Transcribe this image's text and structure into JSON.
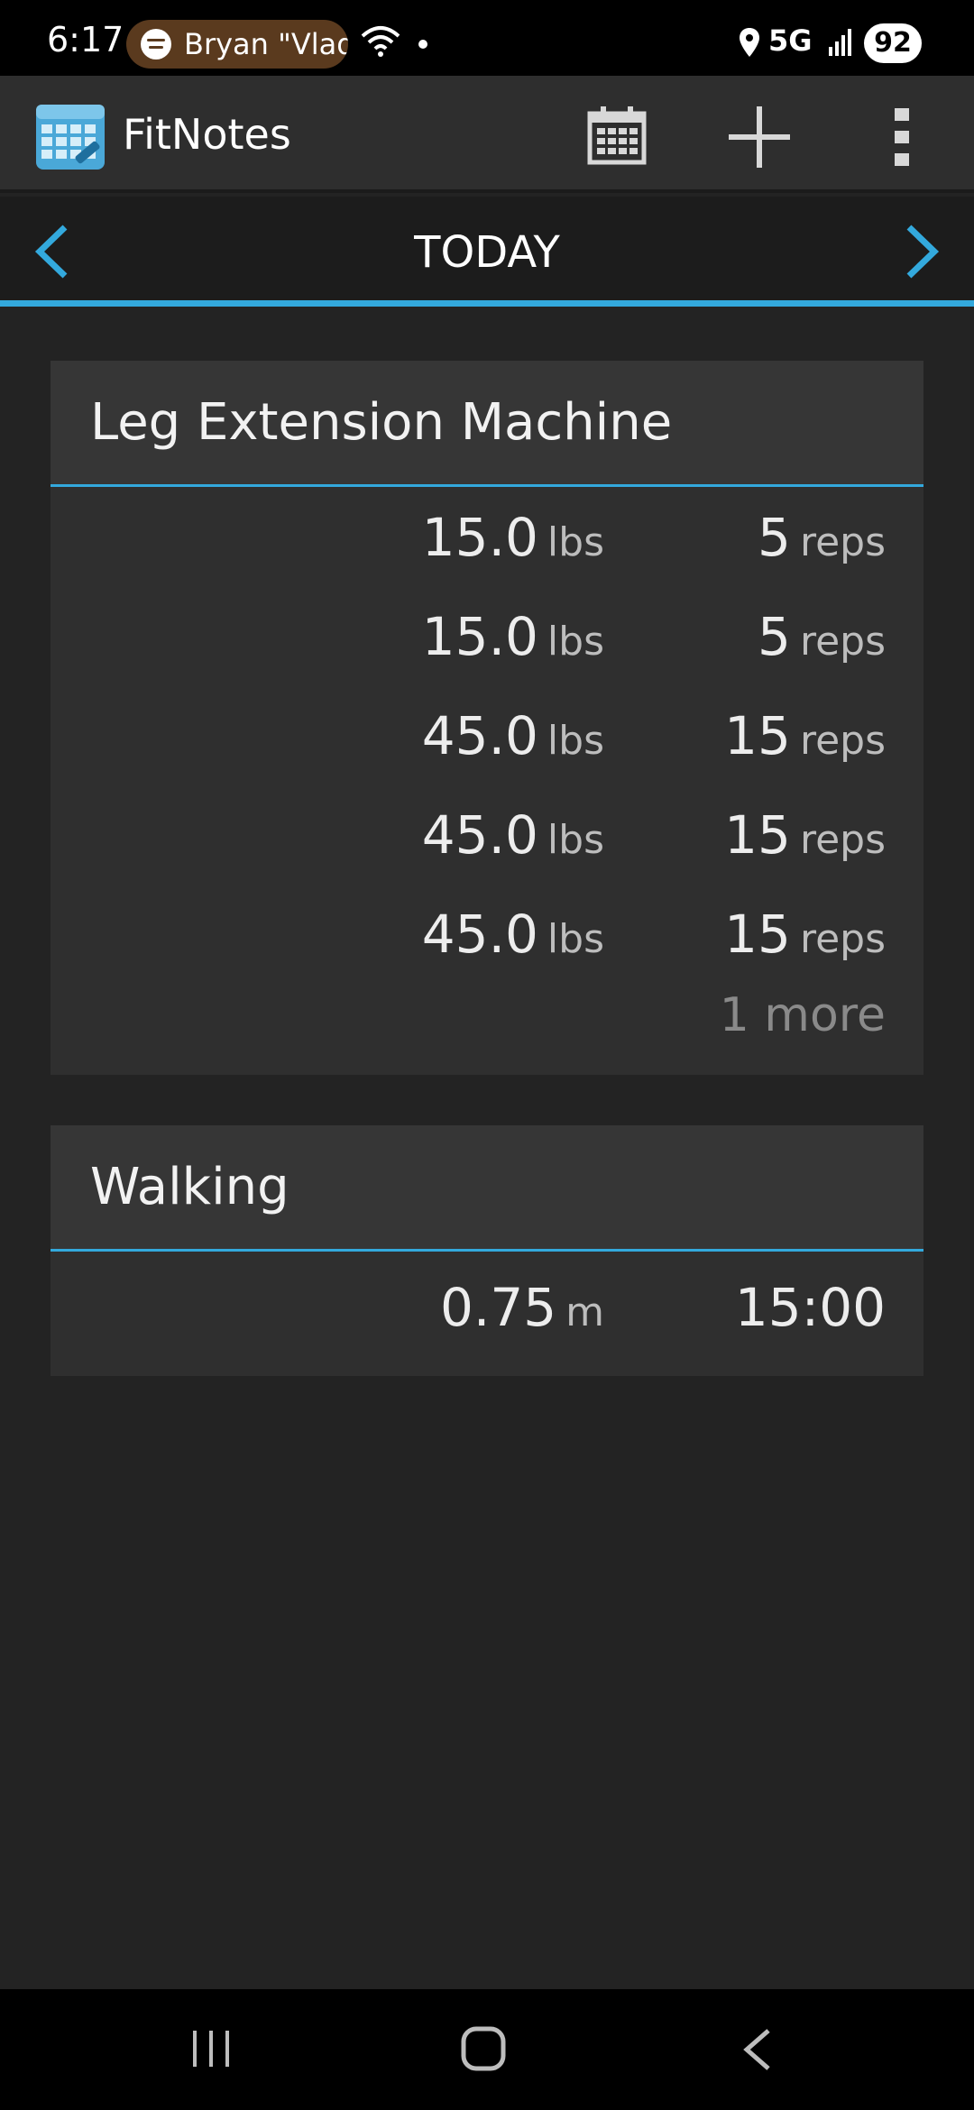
{
  "status_bar": {
    "time": "6:17",
    "media_text": "Bryan \"Vlad",
    "network": "5G",
    "battery": "92"
  },
  "app_bar": {
    "title": "FitNotes",
    "icons": [
      "calendar-icon",
      "plus-icon",
      "more-vert-icon"
    ]
  },
  "date_nav": {
    "label": "TODAY"
  },
  "exercises": [
    {
      "name": "Leg Extension Machine",
      "sets": [
        {
          "weight": "15.0",
          "weight_unit": "lbs",
          "reps": "5",
          "reps_unit": "reps"
        },
        {
          "weight": "15.0",
          "weight_unit": "lbs",
          "reps": "5",
          "reps_unit": "reps"
        },
        {
          "weight": "45.0",
          "weight_unit": "lbs",
          "reps": "15",
          "reps_unit": "reps"
        },
        {
          "weight": "45.0",
          "weight_unit": "lbs",
          "reps": "15",
          "reps_unit": "reps"
        },
        {
          "weight": "45.0",
          "weight_unit": "lbs",
          "reps": "15",
          "reps_unit": "reps"
        }
      ],
      "more_label": "1 more"
    },
    {
      "name": "Walking",
      "sets": [
        {
          "distance": "0.75",
          "distance_unit": "m",
          "time": "15:00"
        }
      ]
    }
  ],
  "colors": {
    "accent": "#33a9dd",
    "background": "#232323",
    "card": "#2f2f2f"
  }
}
